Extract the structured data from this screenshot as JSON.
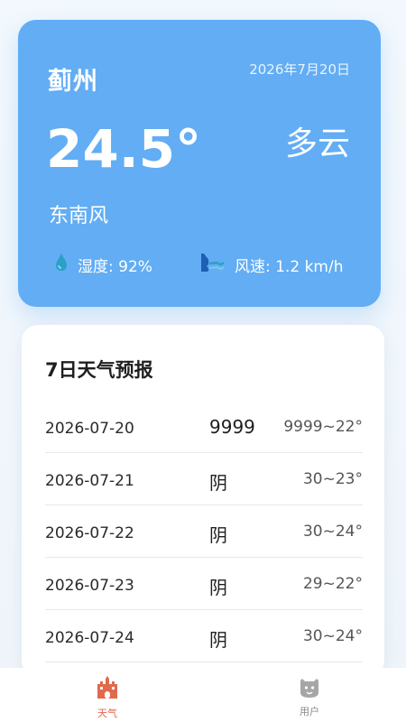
{
  "current": {
    "city": "蓟州",
    "date": "2026年7月20日",
    "temperature": "24.5°",
    "condition": "多云",
    "wind_direction": "东南风",
    "humidity_text": "湿度: 92%",
    "wind_speed_text": "风速: 1.2 km/h"
  },
  "forecast": {
    "title": "7日天气预报",
    "days": [
      {
        "date": "2026-07-20",
        "weather": "9999",
        "range": "9999~22°"
      },
      {
        "date": "2026-07-21",
        "weather": "阴",
        "range": "30~23°"
      },
      {
        "date": "2026-07-22",
        "weather": "阴",
        "range": "30~24°"
      },
      {
        "date": "2026-07-23",
        "weather": "阴",
        "range": "29~22°"
      },
      {
        "date": "2026-07-24",
        "weather": "阴",
        "range": "30~24°"
      }
    ]
  },
  "tabbar": {
    "weather_label": "天气",
    "user_label": "用户",
    "active": "weather"
  },
  "colors": {
    "hero_bg": "#62adf4",
    "active_tab": "#e06a4c",
    "inactive_tab": "#8a8a8a"
  },
  "icons": {
    "humidity": "water-drop-icon",
    "wind": "wind-icon",
    "weather_tab": "castle-icon",
    "user_tab": "user-face-icon"
  }
}
